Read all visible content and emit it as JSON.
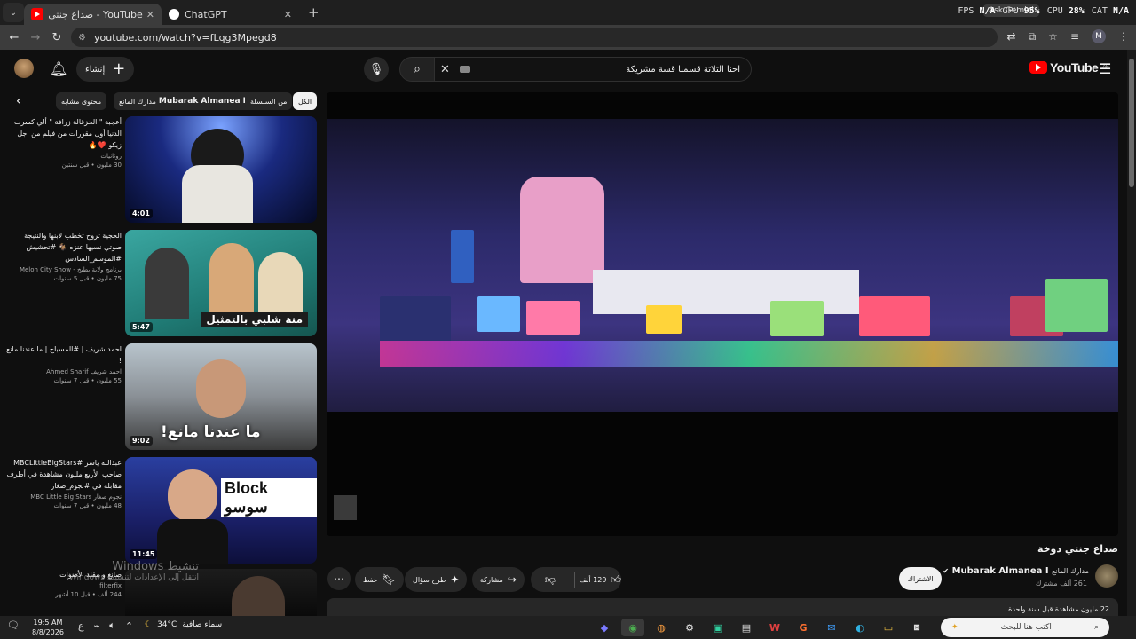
{
  "browser": {
    "tabs": [
      {
        "title": "YouTube - صداع جنتي دوخة"
      },
      {
        "title": "ChatGPT"
      }
    ],
    "new_tab_glyph": "+",
    "url": "youtube.com/watch?v=fLqg3Mpegd8",
    "perf": {
      "fps_label": "FPS",
      "fps_value": "N/A",
      "gpu_label": "GPU",
      "gpu_value": "95%",
      "cpu_label": "CPU",
      "cpu_value": "28%",
      "cat_label": "CAT",
      "cat_value": "N/A"
    },
    "ask_gemini": "Ask Gemini",
    "profile_initial": "M"
  },
  "youtube": {
    "create_label": "إنشاء",
    "search_value": "احنا الثلاثة قسمنا قسة مشريكة",
    "logo_text": "YouTube",
    "logo_region": "AE",
    "chips": [
      "الكل",
      "من السلسلة",
      "من",
      "Mubarak Almanea I",
      "مدارك المانع",
      "محتوى مشابه"
    ],
    "recommendations": [
      {
        "title": "أعجبة \" الحزقالة زرافة \" ألي كسرت الدنيا أول مقررات من فيلم من اجل زيكو ❤️🔥",
        "channel": "روتانيات",
        "views": "30 مليون",
        "age": "قبل سنتين",
        "duration": "4:01"
      },
      {
        "title": "الحجية تروح تخطب لابنها والنتيجة صوتي نسيها عنزه 🐐 #تحشيش #الموسم_السادس",
        "channel": "برنامج ولاية بطيخ - Melon City Show",
        "views": "75 مليون",
        "age": "قبل 5 سنوات",
        "duration": "5:47",
        "overlay": "منة شلبي بالتمثيل"
      },
      {
        "title": "احمد شريف | #المسباح | ما عندنا مانع !",
        "channel": "احمد شريف Ahmed Sharif",
        "views": "55 مليون",
        "age": "قبل 7 سنوات",
        "duration": "9:02",
        "overlay": "ما عندنا مانع!"
      },
      {
        "title": "عبدالله ياسر #MBCLittleBigStars صاحب الأربع مليون مشاهدة في أطرف مقابلة في #نجوم_صغار",
        "channel": "نجوم صغار MBC Little Big Stars",
        "views": "48 مليون",
        "age": "قبل 7 سنوات",
        "duration": "11:45",
        "overlay": "Block سوسو"
      },
      {
        "title": "صانع و مقلد الأصوات",
        "channel": "filterfix",
        "views": "244 ألف",
        "age": "قبل 10 أشهر",
        "duration": ""
      }
    ],
    "video": {
      "title": "صداع جنتي دوخة",
      "channel_name": "Mubarak Almanea I",
      "channel_name_ar": "مدارك المانع",
      "subscribers": "261 ألف مشترك",
      "subscribe_label": "الاشتراك",
      "likes": "129 ألف",
      "share_label": "مشاركة",
      "ask_label": "طرح سؤال",
      "save_label": "حفظ",
      "views": "22 مليون مشاهدة",
      "age": "قبل سنة واحدة"
    }
  },
  "watermark": {
    "line1": "تنشيط Windows",
    "line2": "انتقل إلى الإعدادات لتنشيط Windows."
  },
  "taskbar": {
    "time": "19:5 AM",
    "date": "8/8/2026",
    "lang": "ع",
    "temp": "34°C",
    "weather": "سماء صافية",
    "search_placeholder": "اكتب هنا للبحث"
  }
}
